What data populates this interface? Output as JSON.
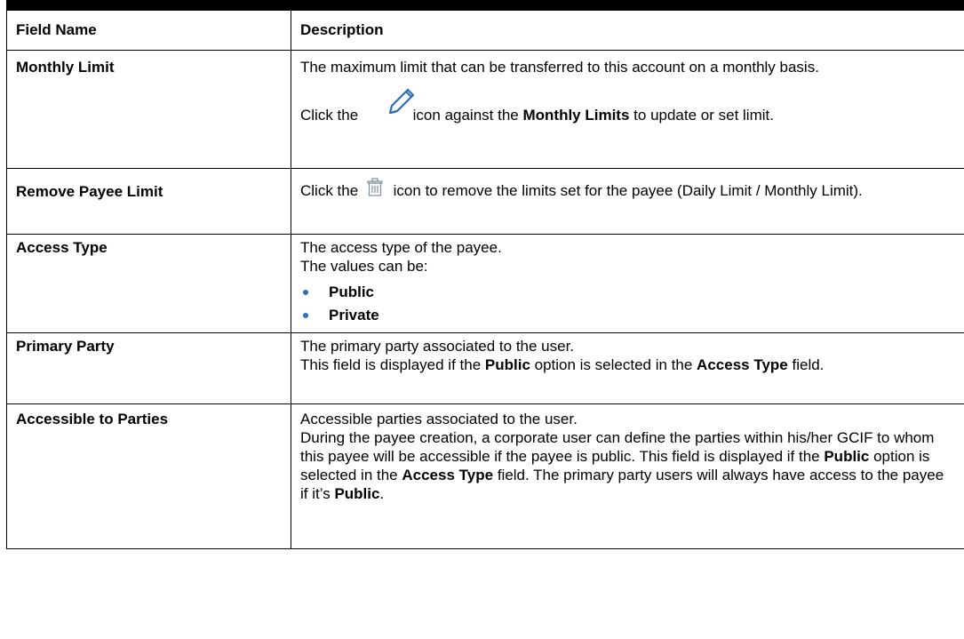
{
  "table": {
    "header": {
      "col1": "Field Name",
      "col2": "Description"
    },
    "rows": [
      {
        "name": "Monthly Limit",
        "desc1": "The maximum limit that can be transferred to this account on a monthly basis.",
        "click_pre": "Click the",
        "click_mid": "icon against the",
        "click_bold": "Monthly Limits",
        "click_post": "to update or set limit.",
        "icon": "pencil-icon"
      },
      {
        "name": "Remove Payee Limit",
        "click_pre": "Click the",
        "click_post": "icon to remove the limits set for the payee (Daily Limit / Monthly Limit).",
        "icon": "trash-icon"
      },
      {
        "name": "Access Type",
        "desc1": "The access type of the payee.",
        "desc2": "The values can be:",
        "values": [
          "Public",
          "Private"
        ]
      },
      {
        "name": "Primary Party",
        "desc1": "The primary party associated to the user.",
        "desc2_pre": "This field is displayed if the",
        "desc2_b1": "Public",
        "desc2_mid": "option is selected in the",
        "desc2_b2": "Access Type",
        "desc2_post": "field."
      },
      {
        "name": "Accessible to Parties",
        "desc1": "Accessible parties associated to the user.",
        "desc2": "During the payee creation, a corporate user can define the parties within his/her GCIF to whom this payee will be accessible if the payee is public. This field is displayed if the",
        "desc2_b1": "Public",
        "desc2_mid": "option is selected in the",
        "desc2_b2": "Access Type",
        "desc2_mid2": "field. The primary party users will always have access to the payee if it’s",
        "desc2_b3": "Public",
        "desc2_post": "."
      }
    ]
  },
  "colors": {
    "bullet": "#2f6db5",
    "pencil": "#2f6db5",
    "trash": "#7a8f9e"
  }
}
